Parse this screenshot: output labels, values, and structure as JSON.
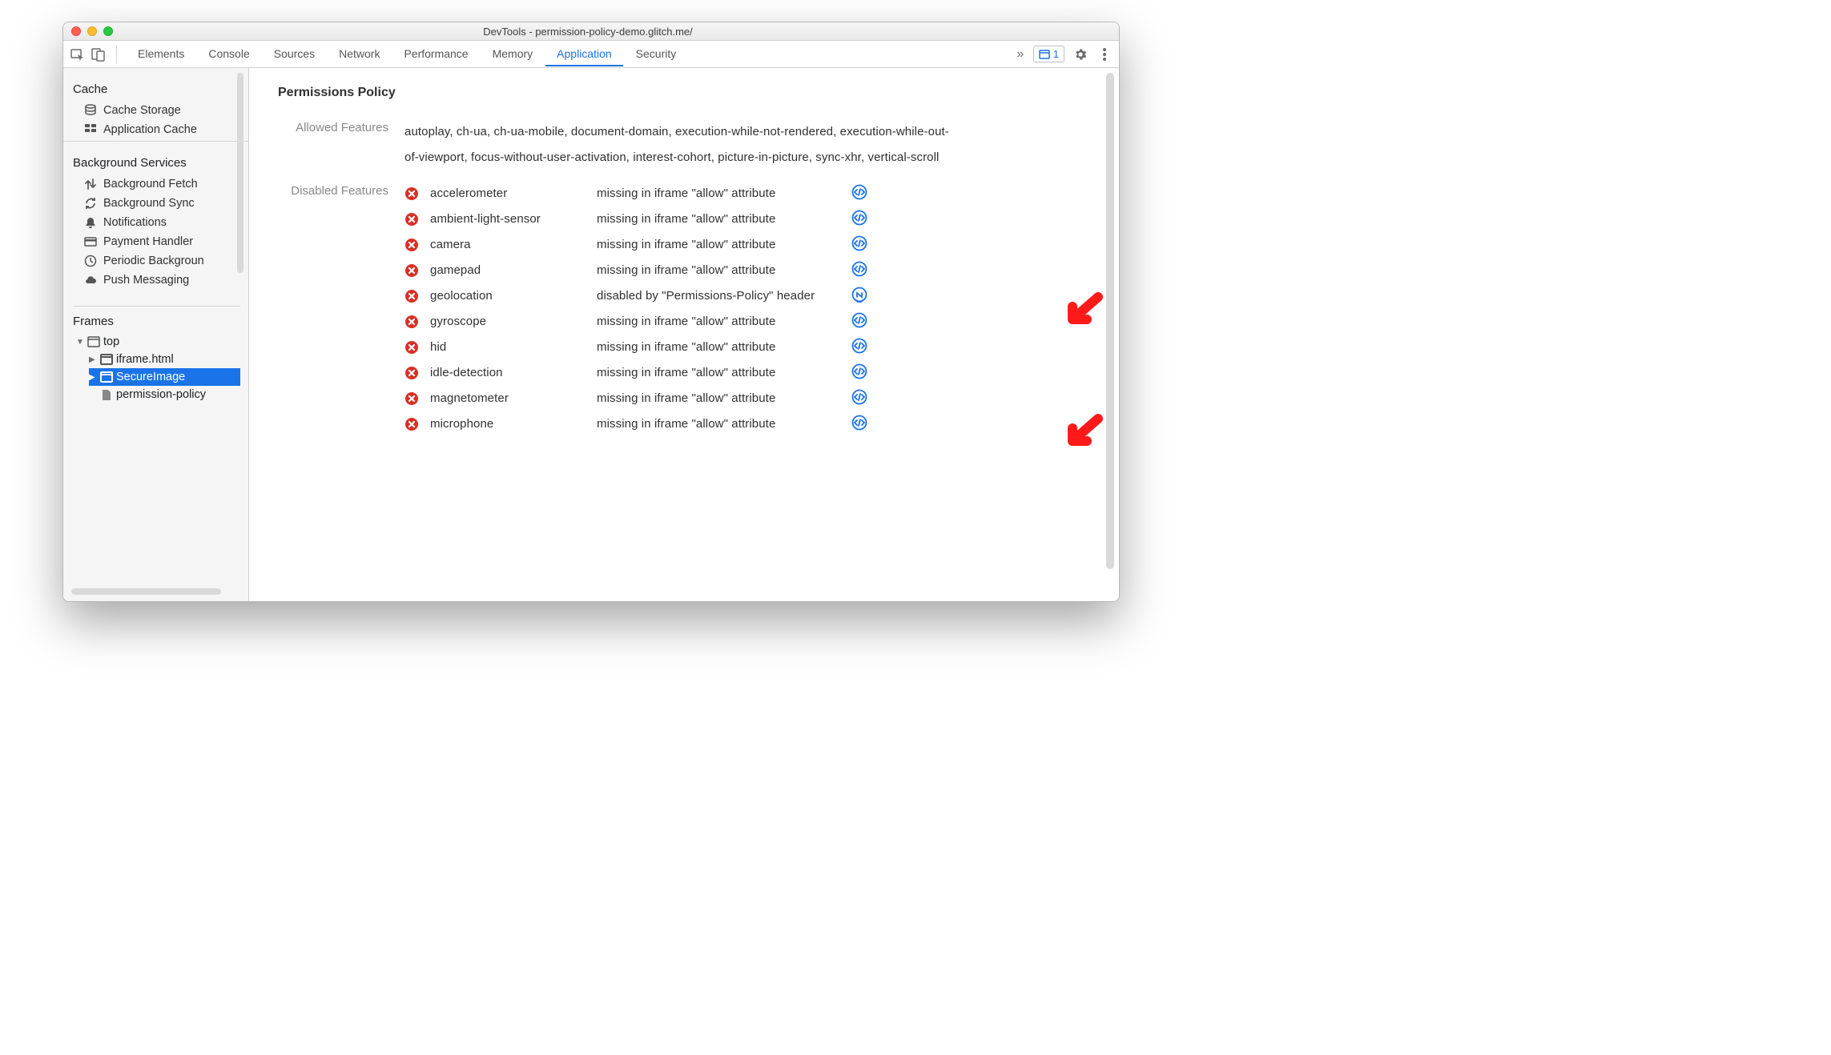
{
  "window": {
    "title": "DevTools - permission-policy-demo.glitch.me/"
  },
  "toolbar": {
    "tabs": [
      "Elements",
      "Console",
      "Sources",
      "Network",
      "Performance",
      "Memory",
      "Application",
      "Security"
    ],
    "active_tab": "Application",
    "issues_count": "1"
  },
  "sidebar": {
    "sections": [
      {
        "title": "Cache",
        "items": [
          {
            "icon": "db",
            "label": "Cache Storage"
          },
          {
            "icon": "grid",
            "label": "Application Cache"
          }
        ]
      },
      {
        "title": "Background Services",
        "items": [
          {
            "icon": "updown",
            "label": "Background Fetch"
          },
          {
            "icon": "sync",
            "label": "Background Sync"
          },
          {
            "icon": "bell",
            "label": "Notifications"
          },
          {
            "icon": "card",
            "label": "Payment Handler"
          },
          {
            "icon": "clock",
            "label": "Periodic Backgroun"
          },
          {
            "icon": "cloud",
            "label": "Push Messaging"
          }
        ]
      }
    ],
    "frames_title": "Frames",
    "frames": {
      "top": "top",
      "children": [
        {
          "icon": "frame",
          "label": "iframe.html",
          "selected": false
        },
        {
          "icon": "frame",
          "label": "SecureImage",
          "selected": true
        },
        {
          "icon": "file",
          "label": "permission-policy",
          "selected": false
        }
      ]
    }
  },
  "main": {
    "heading": "Permissions Policy",
    "allowed_label": "Allowed Features",
    "allowed_text": "autoplay, ch-ua, ch-ua-mobile, document-domain, execution-while-not-rendered, execution-while-out-of-viewport, focus-without-user-activation, interest-cohort, picture-in-picture, sync-xhr, vertical-scroll",
    "disabled_label": "Disabled Features",
    "disabled": [
      {
        "name": "accelerometer",
        "reason": "missing in iframe \"allow\" attribute",
        "link": "code"
      },
      {
        "name": "ambient-light-sensor",
        "reason": "missing in iframe \"allow\" attribute",
        "link": "code"
      },
      {
        "name": "camera",
        "reason": "missing in iframe \"allow\" attribute",
        "link": "code"
      },
      {
        "name": "gamepad",
        "reason": "missing in iframe \"allow\" attribute",
        "link": "code"
      },
      {
        "name": "geolocation",
        "reason": "disabled by \"Permissions-Policy\" header",
        "link": "net"
      },
      {
        "name": "gyroscope",
        "reason": "missing in iframe \"allow\" attribute",
        "link": "code"
      },
      {
        "name": "hid",
        "reason": "missing in iframe \"allow\" attribute",
        "link": "code"
      },
      {
        "name": "idle-detection",
        "reason": "missing in iframe \"allow\" attribute",
        "link": "code"
      },
      {
        "name": "magnetometer",
        "reason": "missing in iframe \"allow\" attribute",
        "link": "code"
      },
      {
        "name": "microphone",
        "reason": "missing in iframe \"allow\" attribute",
        "link": "code"
      }
    ]
  }
}
